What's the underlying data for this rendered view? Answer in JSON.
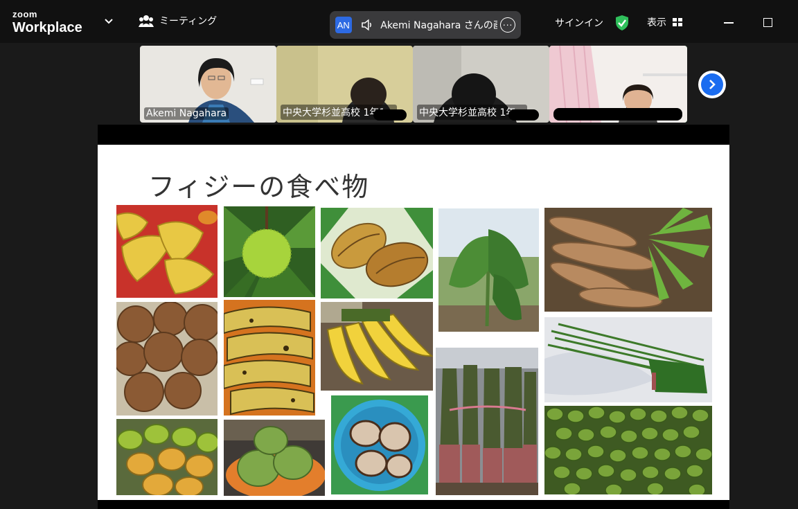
{
  "app": {
    "logo_small": "zoom",
    "logo_big": "Workplace"
  },
  "toolbar": {
    "meeting_label": "ミーティング",
    "share_badge": "AN",
    "share_text": "Akemi Nagahara さんの画面",
    "signin_label": "サインイン",
    "view_label": "表示",
    "colors": {
      "bar": "#111111",
      "pill": "#3a3a3c",
      "badge": "#2d6ae3",
      "shield": "#2fbf5b"
    }
  },
  "participants": [
    {
      "name": "Akemi Nagahara",
      "active": false
    },
    {
      "name": "中央大学杉並高校 1年1...",
      "active": false
    },
    {
      "name": "中央大学杉並高校 1年...",
      "active": false
    },
    {
      "name": "",
      "active": true
    }
  ],
  "slide": {
    "title": "フィジーの食べ物",
    "photos": [
      {
        "icon": "starfruit-photo"
      },
      {
        "icon": "breadfruit-photo"
      },
      {
        "icon": "cacao-photo"
      },
      {
        "icon": "taro-plant-photo"
      },
      {
        "icon": "cassava-photo"
      },
      {
        "icon": "coconut-photo"
      },
      {
        "icon": "plantain-photo"
      },
      {
        "icon": "banana-photo"
      },
      {
        "icon": "long-beans-photo"
      },
      {
        "icon": "papaya-photo"
      },
      {
        "icon": "mango-photo"
      },
      {
        "icon": "breadfruit-sliced-photo"
      },
      {
        "icon": "taro-bundle-photo"
      },
      {
        "icon": "green-fruit-pile-photo"
      }
    ]
  }
}
